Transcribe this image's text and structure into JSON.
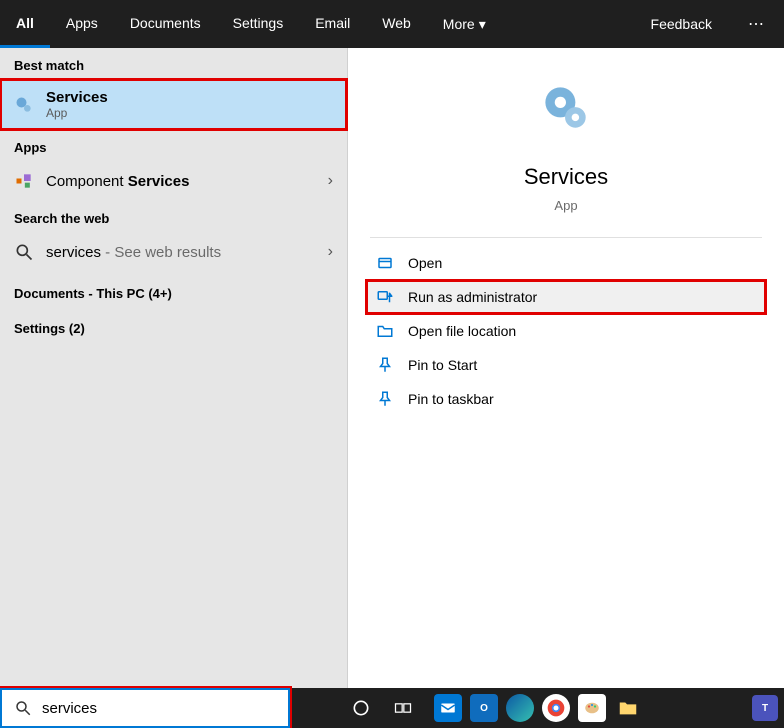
{
  "filters": {
    "all": "All",
    "apps": "Apps",
    "documents": "Documents",
    "settings": "Settings",
    "email": "Email",
    "web": "Web",
    "more": "More",
    "feedback": "Feedback"
  },
  "results": {
    "best_match_header": "Best match",
    "best_match": {
      "title": "Services",
      "subtitle": "App"
    },
    "apps_header": "Apps",
    "component_services_prefix": "Component ",
    "component_services_bold": "Services",
    "search_web_header": "Search the web",
    "web_query": "services",
    "web_suffix": " - See web results",
    "documents_header": "Documents - This PC (4+)",
    "settings_header": "Settings (2)"
  },
  "detail": {
    "title": "Services",
    "subtitle": "App",
    "actions": {
      "open": "Open",
      "run_admin": "Run as administrator",
      "open_location": "Open file location",
      "pin_start": "Pin to Start",
      "pin_taskbar": "Pin to taskbar"
    }
  },
  "search": {
    "value": "services"
  }
}
